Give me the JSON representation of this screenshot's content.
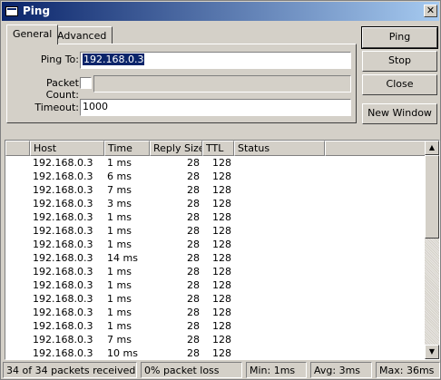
{
  "window": {
    "title": "Ping",
    "close_glyph": "✕"
  },
  "tabs": [
    {
      "label": "General",
      "active": true
    },
    {
      "label": "Advanced",
      "active": false
    }
  ],
  "form": {
    "ping_to": {
      "label": "Ping To:",
      "value": "192.168.0.3"
    },
    "packet_count": {
      "label": "Packet Count:",
      "checked": false,
      "value": ""
    },
    "timeout": {
      "label": "Timeout:",
      "value": "1000"
    }
  },
  "buttons": {
    "ping": "Ping",
    "stop": "Stop",
    "close": "Close",
    "new_window": "New Window"
  },
  "table": {
    "columns": [
      "Host",
      "Time",
      "Reply Size",
      "TTL",
      "Status"
    ],
    "rows": [
      {
        "host": "192.168.0.3",
        "time": "1 ms",
        "size": "28",
        "ttl": "128",
        "status": ""
      },
      {
        "host": "192.168.0.3",
        "time": "6 ms",
        "size": "28",
        "ttl": "128",
        "status": ""
      },
      {
        "host": "192.168.0.3",
        "time": "7 ms",
        "size": "28",
        "ttl": "128",
        "status": ""
      },
      {
        "host": "192.168.0.3",
        "time": "3 ms",
        "size": "28",
        "ttl": "128",
        "status": ""
      },
      {
        "host": "192.168.0.3",
        "time": "1 ms",
        "size": "28",
        "ttl": "128",
        "status": ""
      },
      {
        "host": "192.168.0.3",
        "time": "1 ms",
        "size": "28",
        "ttl": "128",
        "status": ""
      },
      {
        "host": "192.168.0.3",
        "time": "1 ms",
        "size": "28",
        "ttl": "128",
        "status": ""
      },
      {
        "host": "192.168.0.3",
        "time": "14 ms",
        "size": "28",
        "ttl": "128",
        "status": ""
      },
      {
        "host": "192.168.0.3",
        "time": "1 ms",
        "size": "28",
        "ttl": "128",
        "status": ""
      },
      {
        "host": "192.168.0.3",
        "time": "1 ms",
        "size": "28",
        "ttl": "128",
        "status": ""
      },
      {
        "host": "192.168.0.3",
        "time": "1 ms",
        "size": "28",
        "ttl": "128",
        "status": ""
      },
      {
        "host": "192.168.0.3",
        "time": "1 ms",
        "size": "28",
        "ttl": "128",
        "status": ""
      },
      {
        "host": "192.168.0.3",
        "time": "1 ms",
        "size": "28",
        "ttl": "128",
        "status": ""
      },
      {
        "host": "192.168.0.3",
        "time": "7 ms",
        "size": "28",
        "ttl": "128",
        "status": ""
      },
      {
        "host": "192.168.0.3",
        "time": "10 ms",
        "size": "28",
        "ttl": "128",
        "status": ""
      }
    ]
  },
  "scrollbar": {
    "up_glyph": "▲",
    "down_glyph": "▼"
  },
  "status": {
    "received": "34 of 34 packets received",
    "loss": "0% packet loss",
    "min": "Min: 1ms",
    "avg": "Avg: 3ms",
    "max": "Max: 36ms"
  }
}
